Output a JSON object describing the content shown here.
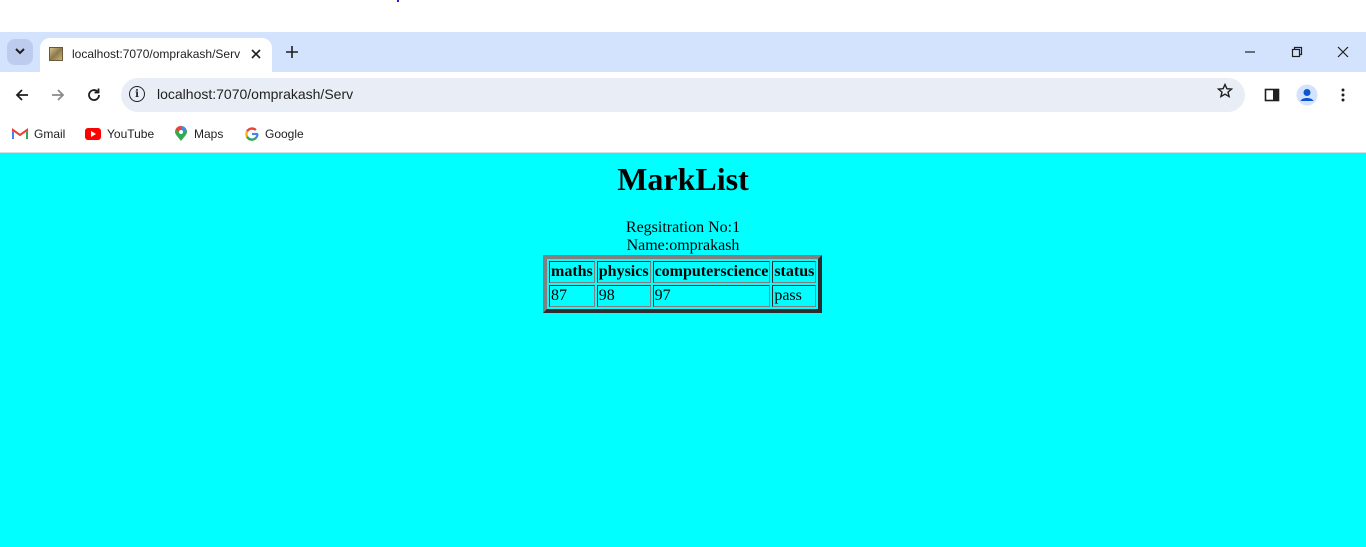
{
  "browser": {
    "tab": {
      "title": "localhost:7070/omprakash/Serv"
    },
    "address_bar": {
      "url": "localhost:7070/omprakash/Serv"
    },
    "bookmarks": [
      {
        "label": "Gmail",
        "icon": "gmail-icon"
      },
      {
        "label": "YouTube",
        "icon": "youtube-icon"
      },
      {
        "label": "Maps",
        "icon": "maps-icon"
      },
      {
        "label": "Google",
        "icon": "google-icon"
      }
    ]
  },
  "page": {
    "background": "#00ffff",
    "heading": "MarkList",
    "registration": "Regsitration No:1",
    "name": "Name:omprakash",
    "table": {
      "headers": [
        "maths",
        "physics",
        "computerscience",
        "status"
      ],
      "rows": [
        [
          "87",
          "98",
          "97",
          "pass"
        ]
      ]
    }
  }
}
